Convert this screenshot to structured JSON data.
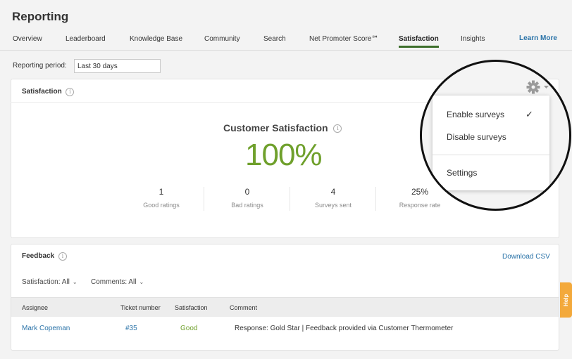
{
  "header": {
    "title": "Reporting"
  },
  "tabs": [
    {
      "label": "Overview"
    },
    {
      "label": "Leaderboard"
    },
    {
      "label": "Knowledge Base"
    },
    {
      "label": "Community"
    },
    {
      "label": "Search"
    },
    {
      "label": "Net Promoter Score℠"
    },
    {
      "label": "Satisfaction",
      "active": true
    },
    {
      "label": "Insights"
    }
  ],
  "learn_more": "Learn More",
  "reporting_period": {
    "label": "Reporting period:",
    "value": "Last 30 days"
  },
  "satisfaction_panel": {
    "title": "Satisfaction",
    "heading": "Customer Satisfaction",
    "value": "100%",
    "stats": [
      {
        "value": "1",
        "label": "Good ratings"
      },
      {
        "value": "0",
        "label": "Bad ratings"
      },
      {
        "value": "4",
        "label": "Surveys sent"
      },
      {
        "value": "25%",
        "label": "Response rate"
      }
    ]
  },
  "settings_menu": {
    "items": [
      {
        "label": "Enable surveys",
        "checked": true
      },
      {
        "label": "Disable surveys"
      },
      {
        "label": "Settings"
      }
    ]
  },
  "feedback_panel": {
    "title": "Feedback",
    "download": "Download CSV",
    "filters": [
      {
        "label": "Satisfaction: All"
      },
      {
        "label": "Comments: All"
      }
    ],
    "columns": [
      "Assignee",
      "Ticket number",
      "Satisfaction",
      "Comment"
    ],
    "rows": [
      {
        "assignee": "Mark Copeman",
        "ticket": "#35",
        "satisfaction": "Good",
        "comment": "Response: Gold Star | Feedback provided via Customer Thermometer"
      }
    ]
  },
  "help_tab": "Help",
  "colors": {
    "accent_green": "#6fa02c",
    "link_blue": "#2a73a8",
    "tab_underline": "#3d6e2b",
    "help_orange": "#f3a93b"
  }
}
